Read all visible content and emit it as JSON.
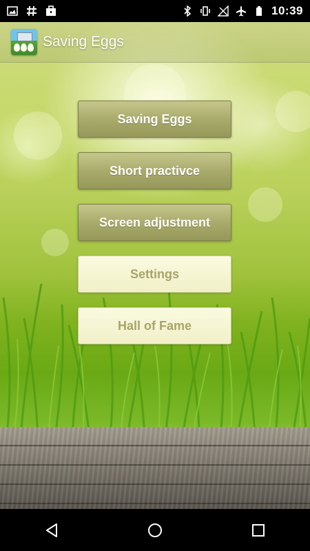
{
  "status_bar": {
    "time": "10:39",
    "left_icons": [
      "image-icon",
      "hash-icon",
      "briefcase-icon"
    ],
    "right_icons": [
      "bluetooth-icon",
      "vibrate-icon",
      "no-signal-icon",
      "airplane-icon",
      "battery-icon"
    ]
  },
  "action_bar": {
    "title": "Saving Eggs",
    "icon": "app-icon"
  },
  "menu": {
    "buttons": [
      {
        "label": "Saving Eggs",
        "style": "dark"
      },
      {
        "label": "Short practivce",
        "style": "dark"
      },
      {
        "label": "Screen adjustment",
        "style": "dark"
      },
      {
        "label": "Settings",
        "style": "light"
      },
      {
        "label": "Hall of Fame",
        "style": "light"
      }
    ]
  },
  "nav_bar": {
    "buttons": [
      "back-icon",
      "home-icon",
      "recents-icon"
    ]
  },
  "colors": {
    "dark_button": "#a7a96a",
    "light_button": "#f1f0c8",
    "light_button_text": "#a8a46a"
  }
}
